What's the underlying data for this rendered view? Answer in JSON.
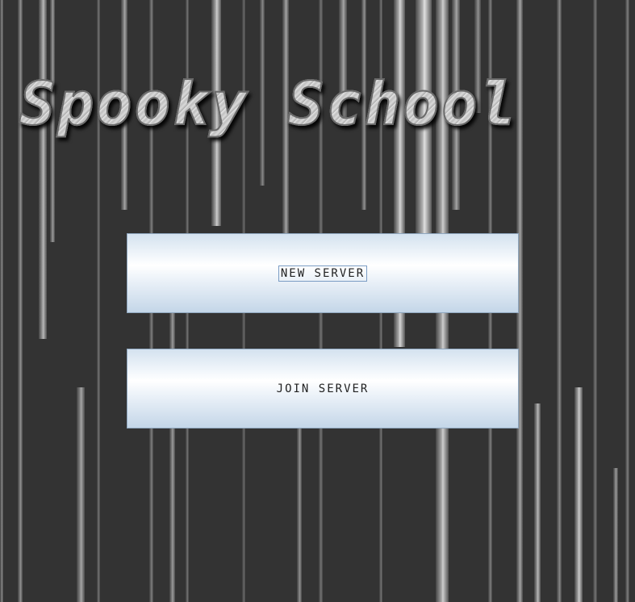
{
  "game": {
    "title": "Spooky School"
  },
  "menu": {
    "new_server_label": "NEW SERVER",
    "join_server_label": "JOIN SERVER",
    "focused": "new_server"
  },
  "colors": {
    "background": "#333333",
    "button_top": "#d4e2ef",
    "button_mid": "#ffffff",
    "button_bottom": "#c4d6e8",
    "button_border": "#8fa7bf",
    "title_fill": "#cfcfcf"
  }
}
